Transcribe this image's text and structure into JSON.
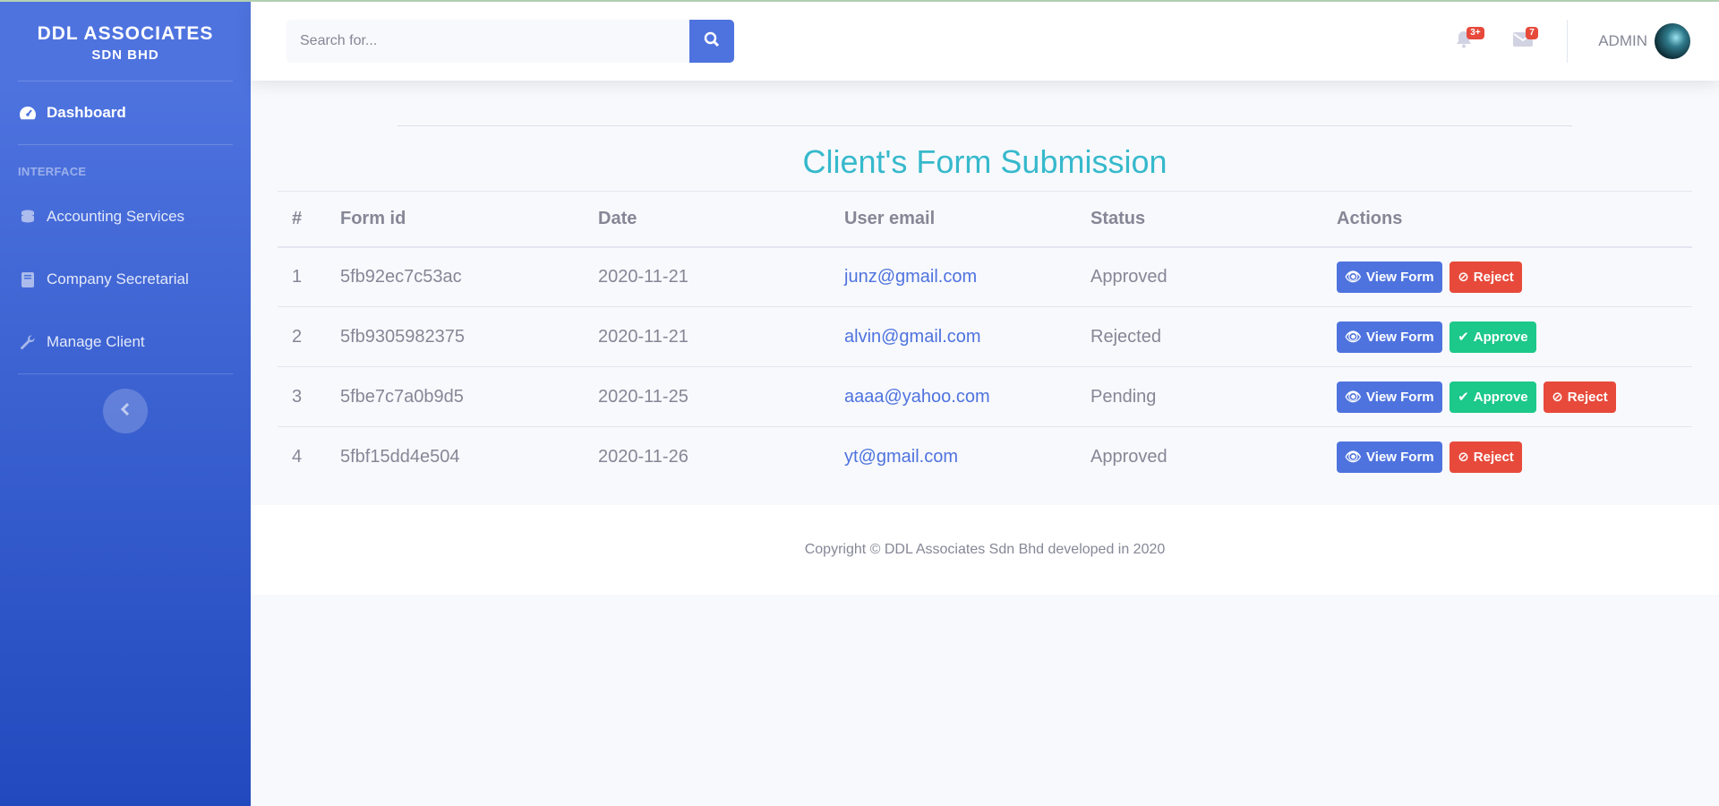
{
  "brand": {
    "line1": "DDL ASSOCIATES",
    "line2": "SDN BHD"
  },
  "sidebar": {
    "dashboard": {
      "label": "Dashboard",
      "icon": "tachometer-icon"
    },
    "heading": "INTERFACE",
    "items": [
      {
        "label": "Accounting Services",
        "icon": "coins-icon"
      },
      {
        "label": "Company Secretarial",
        "icon": "book-icon"
      },
      {
        "label": "Manage Client",
        "icon": "wrench-icon"
      }
    ],
    "toggle_icon": "chevron-left-icon"
  },
  "topbar": {
    "search_placeholder": "Search for...",
    "alerts_badge": "3+",
    "messages_badge": "7",
    "user_name": "ADMIN"
  },
  "main": {
    "title": "Client's Form Submission",
    "columns": [
      "#",
      "Form id",
      "Date",
      "User email",
      "Status",
      "Actions"
    ],
    "rows": [
      {
        "num": "1",
        "form_id": "5fb92ec7c53ac",
        "date": "2020-11-21",
        "email": "junz@gmail.com",
        "status": "Approved"
      },
      {
        "num": "2",
        "form_id": "5fb9305982375",
        "date": "2020-11-21",
        "email": "alvin@gmail.com",
        "status": "Rejected"
      },
      {
        "num": "3",
        "form_id": "5fbe7c7a0b9d5",
        "date": "2020-11-25",
        "email": "aaaa@yahoo.com",
        "status": "Pending"
      },
      {
        "num": "4",
        "form_id": "5fbf15dd4e504",
        "date": "2020-11-26",
        "email": "yt@gmail.com",
        "status": "Approved"
      }
    ],
    "actions": {
      "view": "View Form",
      "reject": "Reject",
      "approve": "Approve"
    }
  },
  "footer": {
    "text": "Copyright © DDL Associates Sdn Bhd developed in 2020"
  },
  "colors": {
    "primary": "#4e73df",
    "danger": "#e74a3b",
    "success": "#1cc88a",
    "info": "#36b9cc"
  }
}
